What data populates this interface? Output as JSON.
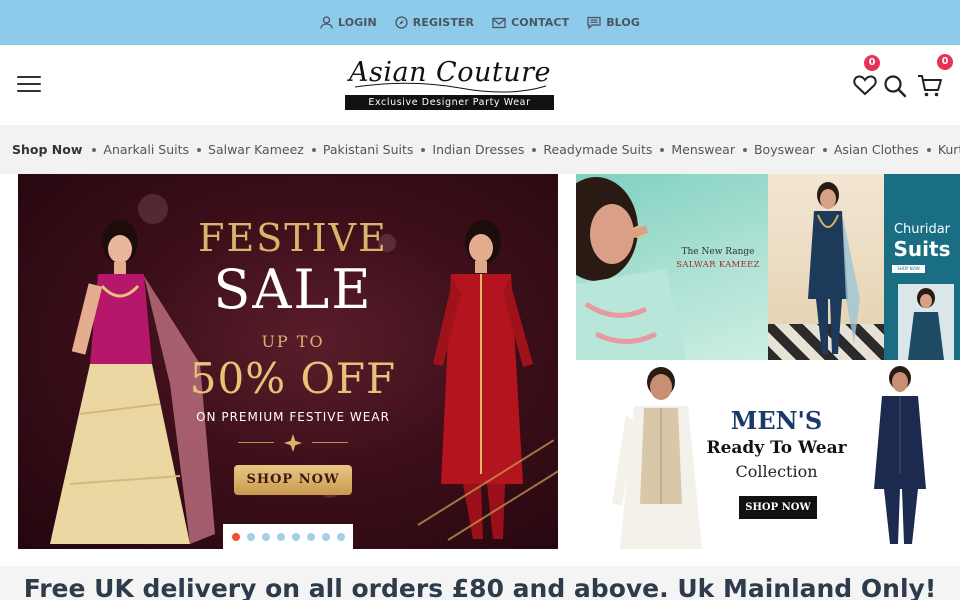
{
  "topbar": {
    "links": [
      {
        "label": "LOGIN",
        "icon": "user-icon"
      },
      {
        "label": "REGISTER",
        "icon": "compass-icon"
      },
      {
        "label": "CONTACT",
        "icon": "mail-icon"
      },
      {
        "label": "BLOG",
        "icon": "chat-icon"
      }
    ],
    "background": "#8ecae9"
  },
  "header": {
    "logo_script": "Asian Couture",
    "logo_tagline": "Exclusive Designer Party Wear",
    "wishlist_count": "0",
    "cart_count": "0",
    "badge_color": "#e8325a"
  },
  "catnav": {
    "lead": "Shop Now",
    "items": [
      "Anarkali Suits",
      "Salwar Kameez",
      "Pakistani Suits",
      "Indian Dresses",
      "Readymade Suits",
      "Menswear",
      "Boyswear",
      "Asian Clothes",
      "Kurt"
    ]
  },
  "hero": {
    "line1": "FESTIVE",
    "line2": "SALE",
    "line3": "UP TO",
    "line4": "50% OFF",
    "line5": "ON PREMIUM FESTIVE WEAR",
    "button": "SHOP NOW",
    "slide_count": 8,
    "active_slide": 1,
    "accent": "#d9b46a"
  },
  "tiles": {
    "salwar": {
      "small": "The New Range",
      "big": "SALWAR KAMEEZ"
    },
    "churidar": {
      "line1": "Churidar",
      "line2": "Suits",
      "cta": "SHOP NOW"
    },
    "mens": {
      "title": "MEN'S",
      "line2": "Ready To Wear",
      "line3": "Collection",
      "cta": "SHOP NOW"
    }
  },
  "delivery": {
    "text": "Free UK delivery on all orders £80 and above. Uk Mainland Only!"
  }
}
